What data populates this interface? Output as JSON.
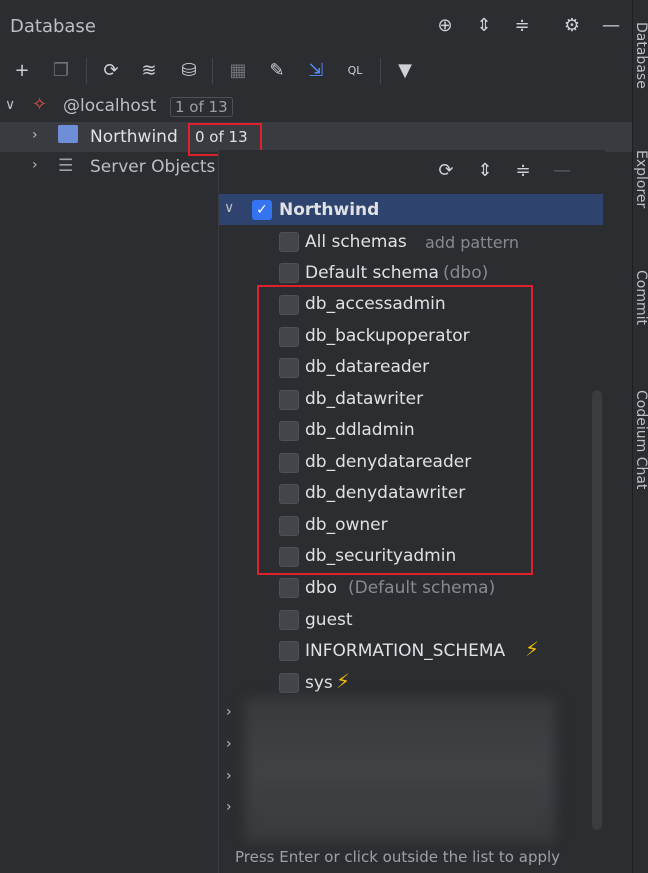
{
  "header": {
    "title": "Database"
  },
  "tree": {
    "localhost_label": "@localhost",
    "localhost_badge": "1 of 13",
    "northwind_label": "Northwind",
    "northwind_badge": "0 of 13",
    "server_objects_label": "Server Objects"
  },
  "popup": {
    "root_label": "Northwind",
    "all_schemas_label": "All schemas",
    "add_pattern_label": "add pattern",
    "default_schema_label": "Default schema",
    "default_schema_hint": "(dbo)",
    "schemas": [
      "db_accessadmin",
      "db_backupoperator",
      "db_datareader",
      "db_datawriter",
      "db_ddladmin",
      "db_denydatareader",
      "db_denydatawriter",
      "db_owner",
      "db_securityadmin"
    ],
    "dbo_label": "dbo",
    "dbo_hint": "(Default schema)",
    "guest_label": "guest",
    "info_schema_label": "INFORMATION_SCHEMA",
    "sys_label": "sys",
    "hint": "Press Enter or click outside the list to apply"
  },
  "right_strip": {
    "tabs": [
      "Database",
      "Explorer",
      "Commit",
      "Codeium Chat"
    ]
  },
  "colors": {
    "accent": "#3574f0",
    "highlight": "#e0202a",
    "selection": "#2e436e"
  }
}
